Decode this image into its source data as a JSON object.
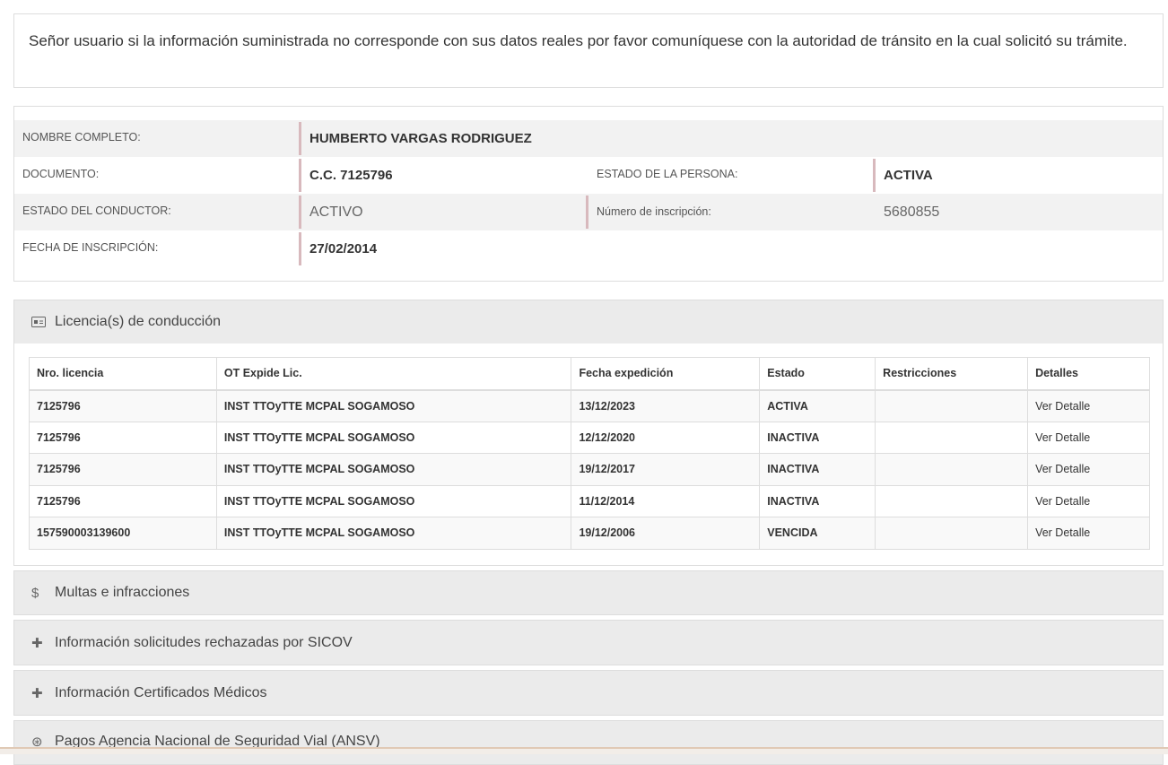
{
  "notice": {
    "text": "Señor usuario si la información suministrada no corresponde con sus datos reales por favor comuníquese con la autoridad de tránsito en la cual solicitó su trámite."
  },
  "person": {
    "nombre_label": "NOMBRE COMPLETO:",
    "nombre_value": "HUMBERTO VARGAS RODRIGUEZ",
    "documento_label": "DOCUMENTO:",
    "documento_value": "C.C. 7125796",
    "estado_persona_label": "ESTADO DE LA PERSONA:",
    "estado_persona_value": "ACTIVA",
    "estado_conductor_label": "ESTADO DEL CONDUCTOR:",
    "estado_conductor_value": "ACTIVO",
    "inscripcion_num_label": "Número de inscripción:",
    "inscripcion_num_value": "5680855",
    "fecha_inscripcion_label": "FECHA DE INSCRIPCIÓN:",
    "fecha_inscripcion_value": "27/02/2014"
  },
  "licencias": {
    "title": "Licencia(s) de conducción",
    "icon": "id-card-icon",
    "columns": [
      "Nro. licencia",
      "OT Expide Lic.",
      "Fecha expedición",
      "Estado",
      "Restricciones",
      "Detalles"
    ],
    "rows": [
      {
        "numero": "7125796",
        "ot": "INST TTOyTTE MCPAL SOGAMOSO",
        "fecha": "13/12/2023",
        "estado": "ACTIVA",
        "restricciones": "",
        "detalles": "Ver Detalle"
      },
      {
        "numero": "7125796",
        "ot": "INST TTOyTTE MCPAL SOGAMOSO",
        "fecha": "12/12/2020",
        "estado": "INACTIVA",
        "restricciones": "",
        "detalles": "Ver Detalle"
      },
      {
        "numero": "7125796",
        "ot": "INST TTOyTTE MCPAL SOGAMOSO",
        "fecha": "19/12/2017",
        "estado": "INACTIVA",
        "restricciones": "",
        "detalles": "Ver Detalle"
      },
      {
        "numero": "7125796",
        "ot": "INST TTOyTTE MCPAL SOGAMOSO",
        "fecha": "11/12/2014",
        "estado": "INACTIVA",
        "restricciones": "",
        "detalles": "Ver Detalle"
      },
      {
        "numero": "157590003139600",
        "ot": "INST TTOyTTE MCPAL SOGAMOSO",
        "fecha": "19/12/2006",
        "estado": "VENCIDA",
        "restricciones": "",
        "detalles": "Ver Detalle"
      }
    ]
  },
  "panels": {
    "multas": {
      "title": "Multas e infracciones",
      "icon": "dollar-icon",
      "glyph": "$"
    },
    "sicov": {
      "title": "Información solicitudes rechazadas por SICOV",
      "icon": "medical-plus-icon",
      "glyph": "✚"
    },
    "medicos": {
      "title": "Información Certificados Médicos",
      "icon": "medical-plus-icon",
      "glyph": "✚"
    },
    "ansv": {
      "title": "Pagos Agencia Nacional de Seguridad Vial (ANSV)",
      "icon": "payment-icon",
      "glyph": "⊛"
    }
  }
}
